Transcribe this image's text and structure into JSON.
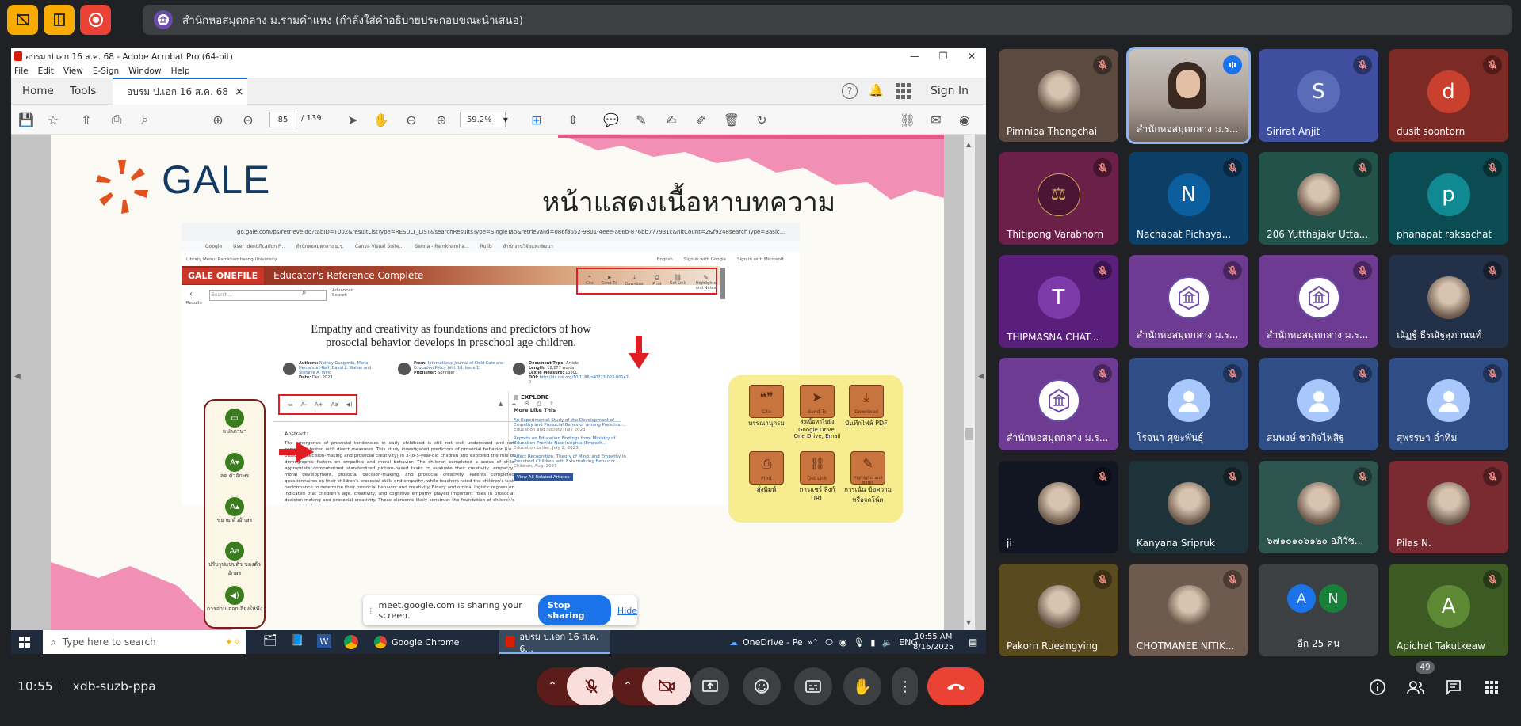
{
  "topbar": {
    "presenter_label": "สำนักหอสมุดกลาง ม.รามคำแหง (กำลังใส่คำอธิบายประกอบขณะนำเสนอ)"
  },
  "acrobat": {
    "window_title": "อบรม ป.เอก 16 ส.ค. 68 - Adobe Acrobat Pro (64-bit)",
    "menu": [
      "File",
      "Edit",
      "View",
      "E-Sign",
      "Window",
      "Help"
    ],
    "tabs": {
      "home": "Home",
      "tools": "Tools",
      "doc": "อบรม ป.เอก 16 ส.ค. 68",
      "close": "×"
    },
    "sign_in": "Sign In",
    "page_current": "85",
    "page_total": "/ 139",
    "zoom": "59.2%"
  },
  "slide": {
    "logo_text": "GALE",
    "title": "หน้าแสดงเนื้อหาบทความ",
    "browser_url": "go.gale.com/ps/retrieve.do?tabID=T002&resultListType=RESULT_LIST&searchResultsType=SingleTab&retrievalId=086fa652-9801-4eee-a66b-876bb777931c&hitCount=2&f9248searchType=Basic...",
    "bookmarks": [
      "Google",
      "User Identification P...",
      "สำนักหอสมุดกลาง ม.ร.",
      "Canva Visual Suite...",
      "Senna - Ramkhamha...",
      "Rulib",
      "สำนักงานวิจัยและพัฒนา"
    ],
    "library_menu": "Library Menu: Ramkhamhaeng University",
    "top_right_links": [
      "English",
      "Sign in with Google",
      "Sign in with Microsoft"
    ],
    "gale_onefile": "GALE ONEFILE",
    "database_name": "Educator's Reference Complete",
    "search_placeholder": "Search...",
    "advanced": "Advanced Search",
    "results": "Results",
    "tool_icons": [
      "Cite",
      "Send To",
      "Download",
      "Print",
      "Get Link",
      "Highlights and Notes"
    ],
    "article_title": "Empathy and creativity as foundations and predictors of how prosocial behavior develops in preschool age children.",
    "authors_label": "Authors:",
    "authors": "Nathdy Gungordu, Maria Hernandez-Reif, David L. Walker and Stefanie A. Wind",
    "date_label": "Date:",
    "date": "Dec. 2023",
    "from_label": "From:",
    "from": "International Journal of Child Care and Education Policy (Vol. 16, Issue 1)",
    "publisher_label": "Publisher:",
    "publisher": "Springer",
    "doctype_label": "Document Type:",
    "doctype": "Article",
    "length_label": "Length:",
    "length": "12,277 words",
    "lexile_label": "Lexile Measure:",
    "lexile": "1380L",
    "doi_label": "DOI:",
    "doi": "http://dx.doi.org/10.1186/s40723-023-00147-0",
    "explore": "EXPLORE",
    "more_like_this": "More Like This",
    "more_items": [
      {
        "title": "An Experimental Study of the Development of Empathy and Prosocial Behavior among Preschoo...",
        "src": "Education and Society, July 2023"
      },
      {
        "title": "Reports on Education Findings from Ministry of Education Provide New Insights (Empath...",
        "src": "Education Letter, July 2, 2023"
      },
      {
        "title": "Affect Recognition, Theory of Mind, and Empathy in Preschool Children with Externalizing Behavior...",
        "src": "Children, Aug. 2023"
      }
    ],
    "view_all": "View All Related Articles",
    "abstract_label": "Abstract:",
    "abstract": "The emergence of prosocial tendencies in early childhood is still not well understood and not commonly tested with direct measures. This study investigated predictors of prosocial behavior (i.e., prosocial decision-making and prosocial creativity) in 3-to-5-year-old children and explored the role of demographic factors on empathic and moral behavior. The children completed a series of child appropriate computerized standardized picture-based tasks to evaluate their creativity, empathy, moral development, prosocial decision-making, and prosocial creativity. Parents completed questionnaires on their children's prosocial skills and empathy, while teachers rated the children's task performance to determine their prosocial behavior and creativity. Binary and ordinal logistic regression indicated that children's age, creativity, and cognitive empathy played important roles in prosocial decision-making and prosocial creativity. These elements likely construct the foundation of children's prosocial behavior.",
    "left_panel": [
      {
        "icon": "▭",
        "label": "แปลภาษา"
      },
      {
        "icon": "A▾",
        "label": "ลด ตัวอักษร"
      },
      {
        "icon": "A▴",
        "label": "ขยาย ตัวอักษร"
      },
      {
        "icon": "Aa",
        "label": "ปรับรูปแบบตัว ของตัวอักษร"
      },
      {
        "icon": "◀)",
        "label": "การอ่าน ออกเสียงให้ฟัง"
      }
    ],
    "right_panel": [
      {
        "icon": "❝❞",
        "sub": "Cite",
        "label": "บรรณานุกรม"
      },
      {
        "icon": "➤",
        "sub": "Send To",
        "label": "ส่งเนื้อหาไปยัง Google Drive, One Drive, Email"
      },
      {
        "icon": "⤓",
        "sub": "Download",
        "label": "บันทึกไฟล์ PDF"
      },
      {
        "icon": "⎙",
        "sub": "Print",
        "label": "สั่งพิมพ์"
      },
      {
        "icon": "⛓",
        "sub": "Get Link",
        "label": "การแชร์ ลิงก์ URL"
      },
      {
        "icon": "✎",
        "sub": "Highlights and Notes",
        "label": "การเน้น ข้อความ หรือจดโน้ต"
      }
    ]
  },
  "share_notice": {
    "text": "meet.google.com is sharing your screen.",
    "stop": "Stop sharing",
    "hide": "Hide"
  },
  "taskbar": {
    "search": "Type here to search",
    "chrome": "Google Chrome",
    "acrobat": "อบรม ป.เอก 16 ส.ค. 6...",
    "onedrive": "OneDrive - Pe",
    "lang": "ENG",
    "time": "10:55 AM",
    "date": "8/16/2025"
  },
  "participants": [
    {
      "name": "Pimnipa Thongchai",
      "type": "photo",
      "color": "#5b4a3f",
      "muted": true
    },
    {
      "name": "สำนักหอสมุดกลาง ม.ร...",
      "type": "video",
      "color": "#8a7f78",
      "muted": false,
      "speaking": true
    },
    {
      "name": "Sirirat Anjit",
      "type": "letter",
      "letter": "S",
      "color": "#3f4e9e",
      "avatar": "#5a6bb8",
      "muted": true
    },
    {
      "name": "dusit soontorn",
      "type": "letter",
      "letter": "d",
      "color": "#7b2a25",
      "avatar": "#c9402e",
      "muted": true
    },
    {
      "name": "Thitipong Varabhorn",
      "type": "seal",
      "color": "#6a2048",
      "muted": true
    },
    {
      "name": "Nachapat Pichaya...",
      "type": "letter",
      "letter": "N",
      "color": "#0d3f66",
      "avatar": "#0b5f9e",
      "muted": true
    },
    {
      "name": "206 Yutthajakr Utta...",
      "type": "photo",
      "color": "#22524a",
      "muted": true
    },
    {
      "name": "phanapat raksachat",
      "type": "letter",
      "letter": "p",
      "color": "#0b4c52",
      "avatar": "#0f8a93",
      "muted": true
    },
    {
      "name": "THIPMASNA CHAT...",
      "type": "letter",
      "letter": "T",
      "color": "#5a1f7a",
      "avatar": "#7d3aa8",
      "muted": true
    },
    {
      "name": "สำนักหอสมุดกลาง ม.ร...",
      "type": "logo",
      "color": "#6e3b92",
      "muted": true
    },
    {
      "name": "สำนักหอสมุดกลาง ม.ร...",
      "type": "logo",
      "color": "#6e3b92",
      "muted": true
    },
    {
      "name": "ณัฏฐ์ ธีรณัฐสุภานนท์",
      "type": "photo",
      "color": "#223148",
      "muted": true
    },
    {
      "name": "สำนักหอสมุดกลาง ม.ร...",
      "type": "logo",
      "color": "#6e3b92",
      "muted": true
    },
    {
      "name": "โรจนา ศุขะพันธุ์",
      "type": "person",
      "color": "#2f4e86",
      "muted": true
    },
    {
      "name": "สมพงษ์ ชวกิจไพสิฐ",
      "type": "person",
      "color": "#2f4e86",
      "muted": true
    },
    {
      "name": "สุพรรษา อ่ำทิม",
      "type": "person",
      "color": "#2f4e86",
      "muted": true
    },
    {
      "name": "ji",
      "type": "photo",
      "color": "#111622",
      "muted": true
    },
    {
      "name": "Kanyana Sripruk",
      "type": "photo",
      "color": "#1e3339",
      "muted": true
    },
    {
      "name": "๖๗๑๐๑๐๖๑๒๐ อภิวัช...",
      "type": "photo",
      "color": "#2e5450",
      "muted": true
    },
    {
      "name": "Pilas N.",
      "type": "photo",
      "color": "#7a2b31",
      "muted": true
    },
    {
      "name": "Pakorn Rueangying",
      "type": "photo",
      "color": "#5a4a20",
      "muted": true
    },
    {
      "name": "CHOTMANEE NITIK...",
      "type": "photo",
      "color": "#6e5b50",
      "muted": true
    },
    {
      "name": "อีก 25 คน",
      "type": "others",
      "color": "#3c4043",
      "letters": [
        "A",
        "N"
      ],
      "muted": false
    },
    {
      "name": "Apichet Takutkeaw",
      "type": "letter",
      "letter": "A",
      "color": "#3d5a24",
      "avatar": "#5f8a35",
      "muted": true
    }
  ],
  "bottom": {
    "time": "10:55",
    "meeting_code": "xdb-suzb-ppa",
    "participant_count": "49"
  },
  "colors": {
    "accent_red": "#ea4335",
    "meet_bg": "#202124",
    "pill": "#3c4043",
    "slide_red": "#e11d24",
    "gale_orange": "#e0521f",
    "gale_navy": "#123a63",
    "yellow_panel": "#f7ec90",
    "mute_badge_icon": "#f28b82"
  }
}
